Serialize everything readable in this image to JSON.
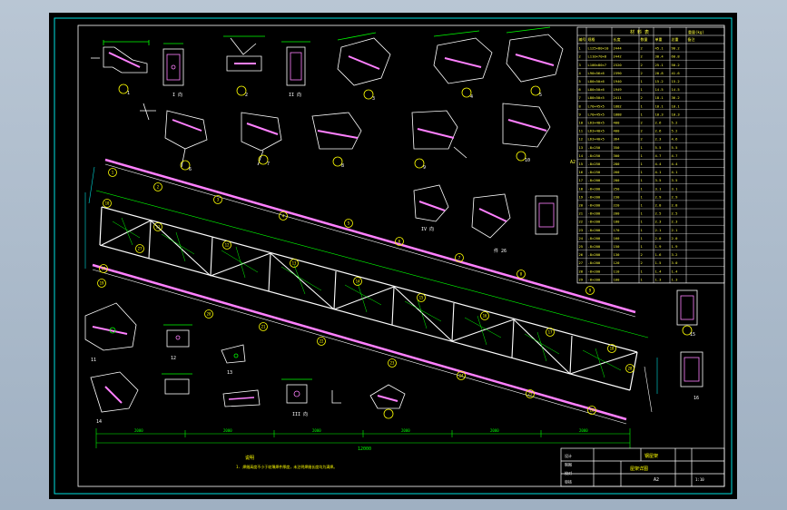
{
  "drawing": {
    "bom_title": "材 料 表",
    "bom_weight_label": "重量(kg)",
    "bom_columns": [
      "编号",
      "规格",
      "长度",
      "数量",
      "单重",
      "总重",
      "备注"
    ],
    "bom_rows": [
      [
        "1",
        "L125×80×10",
        "2444",
        "2",
        "45.1",
        "90.2"
      ],
      [
        "2",
        "L110×70×8",
        "2442",
        "2",
        "30.4",
        "60.8"
      ],
      [
        "3",
        "L100×80×7",
        "2320",
        "2",
        "25.1",
        "50.2"
      ],
      [
        "4",
        "L90×56×6",
        "2390",
        "2",
        "20.8",
        "41.6"
      ],
      [
        "5",
        "L80×50×6",
        "1940",
        "1",
        "15.2",
        "15.2"
      ],
      [
        "6",
        "L80×50×6",
        "1949",
        "1",
        "14.5",
        "14.5"
      ],
      [
        "7",
        "L80×50×5",
        "2411",
        "2",
        "18.1",
        "36.2"
      ],
      [
        "8",
        "L70×45×5",
        "1882",
        "1",
        "10.1",
        "10.1"
      ],
      [
        "9",
        "L70×45×5",
        "1888",
        "1",
        "10.3",
        "10.3"
      ],
      [
        "10",
        "L63×40×5",
        "400",
        "2",
        "2.6",
        "5.2"
      ],
      [
        "11",
        "L63×40×5",
        "400",
        "2",
        "2.6",
        "5.2"
      ],
      [
        "12",
        "L63×40×5",
        "364",
        "2",
        "2.3",
        "4.6"
      ],
      [
        "13",
        "-8×250",
        "350",
        "1",
        "5.5",
        "5.5"
      ],
      [
        "14",
        "-8×250",
        "300",
        "1",
        "4.7",
        "4.7"
      ],
      [
        "15",
        "-8×250",
        "280",
        "1",
        "4.4",
        "4.4"
      ],
      [
        "16",
        "-8×250",
        "260",
        "1",
        "4.1",
        "4.1"
      ],
      [
        "17",
        "-8×200",
        "280",
        "1",
        "3.5",
        "3.5"
      ],
      [
        "18",
        "-8×200",
        "250",
        "1",
        "3.1",
        "3.1"
      ],
      [
        "19",
        "-8×200",
        "230",
        "1",
        "2.9",
        "2.9"
      ],
      [
        "20",
        "-8×200",
        "220",
        "1",
        "2.8",
        "2.8"
      ],
      [
        "21",
        "-8×200",
        "200",
        "1",
        "2.5",
        "2.5"
      ],
      [
        "22",
        "-8×200",
        "180",
        "1",
        "2.3",
        "2.3"
      ],
      [
        "23",
        "-8×200",
        "170",
        "1",
        "2.1",
        "2.1"
      ],
      [
        "24",
        "-8×200",
        "160",
        "1",
        "2.0",
        "2.0"
      ],
      [
        "25",
        "-8×200",
        "150",
        "1",
        "1.9",
        "1.9"
      ],
      [
        "26",
        "-8×200",
        "130",
        "2",
        "1.6",
        "3.2"
      ],
      [
        "27",
        "-8×200",
        "120",
        "2",
        "1.5",
        "3.0"
      ],
      [
        "28",
        "-8×200",
        "110",
        "1",
        "1.4",
        "1.4"
      ],
      [
        "29",
        "-8×200",
        "100",
        "1",
        "1.3",
        "1.3"
      ]
    ],
    "bom_side_label": "A2",
    "view_labels": [
      "1",
      "I 向",
      "2",
      "II 向",
      "3",
      "4",
      "5",
      "6",
      "7",
      "8",
      "9",
      "10",
      "11",
      "12",
      "13",
      "14",
      "15",
      "16",
      "III 向",
      "IV 向",
      "件 26"
    ],
    "bubbles": [
      "1",
      "2",
      "3",
      "4",
      "5",
      "6",
      "7",
      "8",
      "9",
      "10",
      "11",
      "12",
      "13",
      "14",
      "15",
      "16",
      "17",
      "18",
      "19",
      "20",
      "21",
      "22",
      "23",
      "24",
      "25",
      "26",
      "27",
      "28",
      "29"
    ],
    "dim_total": "12000",
    "dims_bottom": [
      "2000",
      "2000",
      "2000",
      "2000",
      "2000",
      "2000"
    ],
    "notes_title": "说明",
    "notes_line": "1. 焊缝高度不小于较薄焊件厚度，未注明焊缝长度均为满焊。",
    "title_block": {
      "project": "钢屋架",
      "drawing_name": "屋架详图",
      "sheet_size": "A2",
      "scale": "1:10",
      "rows": [
        "设计",
        "制图",
        "校对",
        "审核"
      ]
    },
    "colors": {
      "frame": "#00e0e0",
      "chord": "#ff80ff",
      "member": "#ffffff",
      "dim": "#00ff00",
      "text": "#00ff00",
      "bubble": "#ffff00",
      "table": "#ffff40"
    }
  }
}
